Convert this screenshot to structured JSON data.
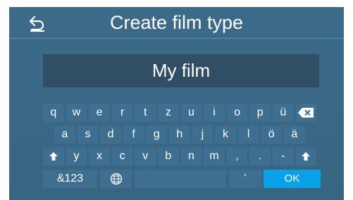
{
  "header": {
    "title": "Create film type",
    "back_icon": "back-arrow-icon"
  },
  "name_field": {
    "value": "My film"
  },
  "keyboard": {
    "row1": [
      "q",
      "w",
      "e",
      "r",
      "t",
      "z",
      "u",
      "i",
      "o",
      "p",
      "ü"
    ],
    "row1_backspace_icon": "backspace-icon",
    "row2": [
      "a",
      "s",
      "d",
      "f",
      "g",
      "h",
      "j",
      "k",
      "l",
      "ö",
      "ä"
    ],
    "row3_shift_icon": "shift-up-icon",
    "row3": [
      "y",
      "x",
      "c",
      "v",
      "b",
      "n",
      "m",
      ",",
      "."
    ],
    "row3_dash": "-",
    "row4": {
      "symbols": "&123",
      "globe_icon": "globe-icon",
      "space": "",
      "apostrophe": "'",
      "ok": "OK"
    }
  },
  "colors": {
    "background": "#3c6a89",
    "key": "#3f6f90",
    "field": "#304e64",
    "ok": "#0aa1e9"
  }
}
